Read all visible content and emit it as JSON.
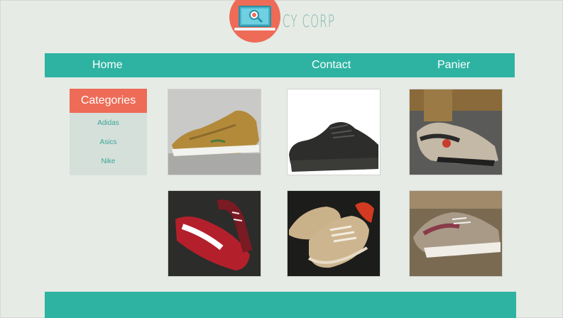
{
  "logo": {
    "text": "CY CORP",
    "icon": "computer-magnifier-icon"
  },
  "nav": {
    "items": [
      "Home",
      "Contact",
      "Panier"
    ]
  },
  "categories": {
    "title": "Categories",
    "items": [
      "Adidas",
      "Asics",
      "Nike"
    ]
  },
  "colors": {
    "teal": "#2eb3a3",
    "coral": "#ee6b57",
    "background": "#e6ebe5"
  },
  "products": [
    {
      "name": "shoe-image-gold-runner"
    },
    {
      "name": "shoe-image-black-knit"
    },
    {
      "name": "shoe-image-grey-red-on-feet"
    },
    {
      "name": "shoe-image-red-white"
    },
    {
      "name": "shoe-image-tan-suede"
    },
    {
      "name": "shoe-image-grey-pink"
    }
  ]
}
